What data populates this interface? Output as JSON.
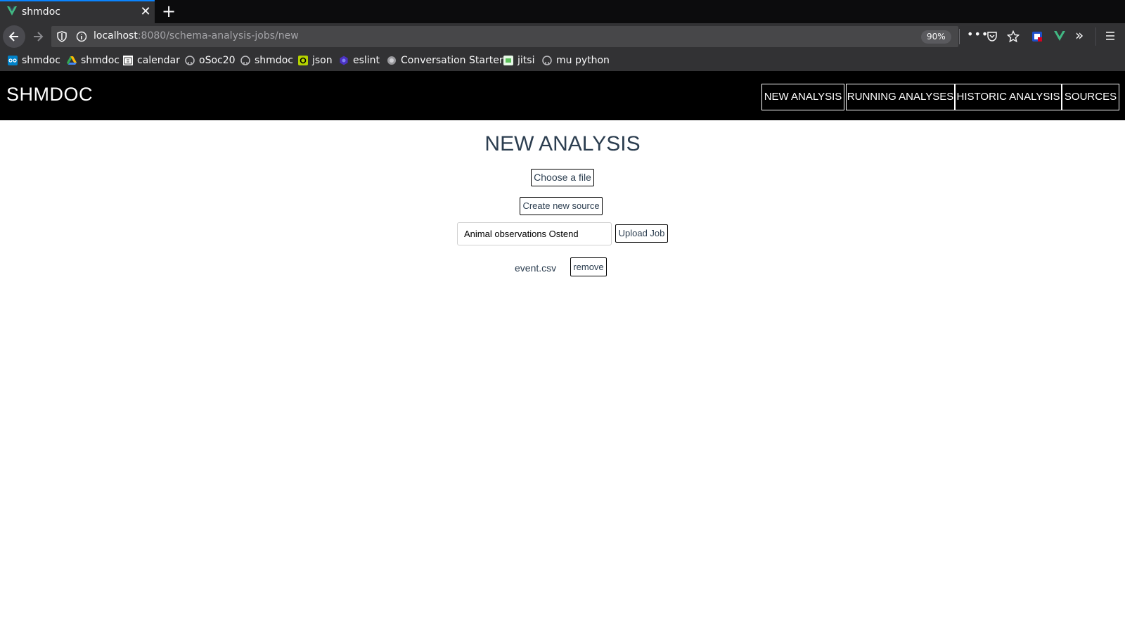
{
  "browser": {
    "tab": {
      "title": "shmdoc",
      "close": "✕"
    },
    "new_tab": "+",
    "url": {
      "host": "localhost",
      "path": ":8080/schema-analysis-jobs/new"
    },
    "zoom": "90%",
    "more": "•••",
    "overflow": "»",
    "bookmarks": [
      {
        "label": "shmdoc",
        "icon": "nextcloud-icon"
      },
      {
        "label": "shmdoc",
        "icon": "google-drive-icon"
      },
      {
        "label": "calendar",
        "icon": "calendar-icon"
      },
      {
        "label": "oSoc20",
        "icon": "github-icon"
      },
      {
        "label": "shmdoc",
        "icon": "github-icon"
      },
      {
        "label": "json",
        "icon": "json-icon"
      },
      {
        "label": "eslint",
        "icon": "eslint-icon"
      },
      {
        "label": "Conversation Starter",
        "icon": "globe-icon"
      },
      {
        "label": "jitsi",
        "icon": "jitsi-icon"
      },
      {
        "label": "mu python",
        "icon": "github-icon"
      }
    ]
  },
  "app": {
    "brand": "SHMDOC",
    "menu": [
      "NEW ANALYSIS",
      "RUNNING ANALYSES",
      "HISTORIC ANALYSIS",
      "SOURCES"
    ],
    "page_title": "NEW ANALYSIS",
    "choose_file": "Choose a file",
    "create_source": "Create new source",
    "selected_source": "Animal observations Ostend",
    "upload_job": "Upload Job",
    "file_name": "event.csv",
    "remove": "remove"
  },
  "colors": {
    "accent": "#0a84ff",
    "header_bg": "#000000",
    "title_text": "#2c3e50",
    "vue_green": "#41b883"
  }
}
